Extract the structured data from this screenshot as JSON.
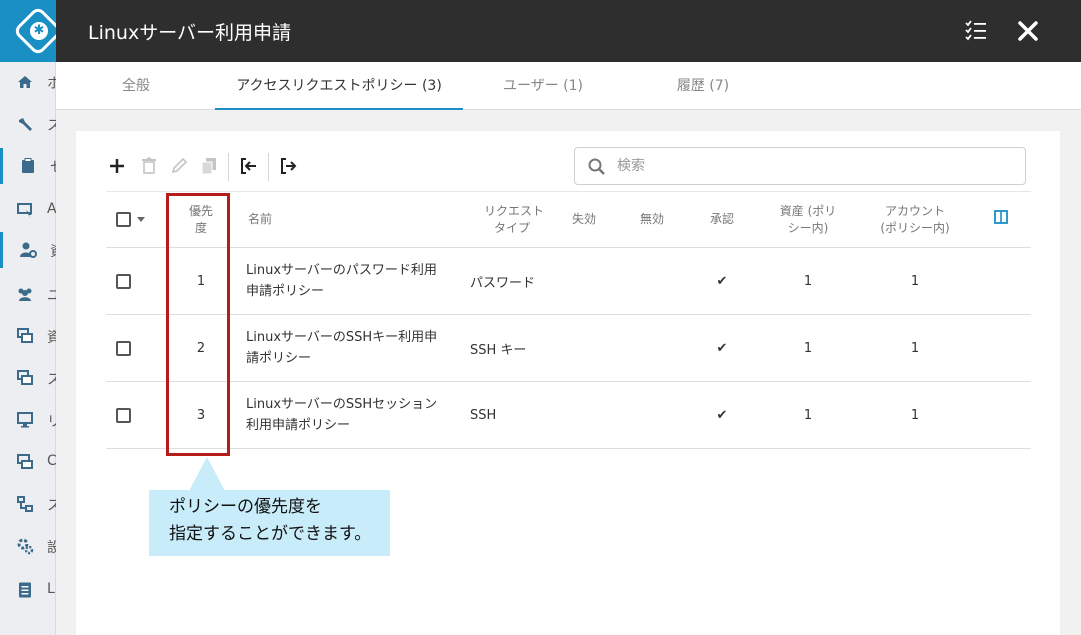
{
  "background_sidebar": {
    "items": [
      {
        "icon": "home-icon",
        "label": "ホ"
      },
      {
        "icon": "wrench-icon",
        "label": "ス"
      },
      {
        "icon": "clipboard-icon",
        "label": "セ"
      },
      {
        "icon": "monitor-pointer-icon",
        "label": "A"
      },
      {
        "icon": "user-gear-icon",
        "label": "資"
      },
      {
        "icon": "users-icon",
        "label": "ユ"
      },
      {
        "icon": "windows-icon",
        "label": "資"
      },
      {
        "icon": "windows-icon",
        "label": "ス"
      },
      {
        "icon": "monitor-icon",
        "label": "リ"
      },
      {
        "icon": "chat-icon",
        "label": "C"
      },
      {
        "icon": "network-icon",
        "label": "ス"
      },
      {
        "icon": "gears-icon",
        "label": "設"
      },
      {
        "icon": "document-icon",
        "label": "L"
      }
    ]
  },
  "modal": {
    "title": "Linuxサーバー利用申請",
    "tabs": [
      {
        "label": "全般",
        "active": false
      },
      {
        "label": "アクセスリクエストポリシー (3)",
        "active": true
      },
      {
        "label": "ユーザー (1)",
        "active": false
      },
      {
        "label": "履歴 (7)",
        "active": false
      }
    ]
  },
  "search": {
    "placeholder": "検索",
    "value": ""
  },
  "table": {
    "headers": {
      "priority": [
        "優先",
        "度"
      ],
      "name": "名前",
      "request_type": [
        "リクエスト",
        "タイプ"
      ],
      "expired": "失効",
      "disabled": "無効",
      "approval": "承認",
      "assets": [
        "資産 (ポリ",
        "シー内)"
      ],
      "accounts": [
        "アカウント",
        "(ポリシー内)"
      ]
    },
    "rows": [
      {
        "priority": "1",
        "name": [
          "Linuxサーバーのパスワード利用",
          "申請ポリシー"
        ],
        "request_type": "パスワード",
        "expired": "",
        "disabled": "",
        "approval": "✔",
        "assets": "1",
        "accounts": "1"
      },
      {
        "priority": "2",
        "name": [
          "LinuxサーバーのSSHキー利用申",
          "請ポリシー"
        ],
        "request_type": "SSH キー",
        "expired": "",
        "disabled": "",
        "approval": "✔",
        "assets": "1",
        "accounts": "1"
      },
      {
        "priority": "3",
        "name": [
          "LinuxサーバーのSSHセッション",
          "利用申請ポリシー"
        ],
        "request_type": "SSH",
        "expired": "",
        "disabled": "",
        "approval": "✔",
        "assets": "1",
        "accounts": "1"
      }
    ]
  },
  "callout": {
    "line1": "ポリシーの優先度を",
    "line2": "指定することができます。"
  },
  "colors": {
    "accent": "#1a8fc4",
    "header_bg": "#2e2e2e",
    "highlight_border": "#b51d1d",
    "callout_bg": "#c8ecf9"
  }
}
